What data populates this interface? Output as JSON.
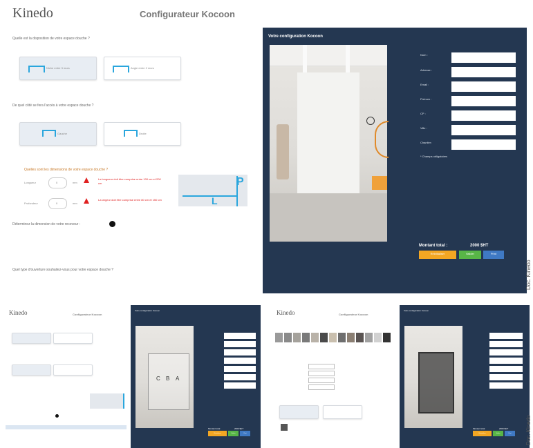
{
  "top": {
    "logo": "Kinedo",
    "title": "Configurateur Kocoon",
    "q1": "Quelle est la disposition de votre espace douche ?",
    "q1_opt1": "Niche entre 3 murs",
    "q1_opt2": "Angle entre 2 murs",
    "q2": "De quel côté se fera l'accès à votre espace douche ?",
    "q2_opt1": "Gauche",
    "q2_opt2": "Droite",
    "q3": "Quelles sont les dimensions de votre espace douche ?",
    "length_label": "Longueur",
    "length_value": "0",
    "length_unit": "mm",
    "length_error": "La longueur doit être comprise entre 100 cm et 200 cm",
    "depth_label": "Profondeur",
    "depth_value": "0",
    "depth_unit": "mm",
    "depth_error": "La largeur doit être comprise entre 80 cm et 150 cm",
    "diagram_p": "P",
    "diagram_l": "L",
    "dims_hint": "Déterminez la dimension de votre receveur :",
    "q4": "Quel type d'ouverture souhaitez-vous pour votre espace douche ?",
    "panel_title": "Votre configuration Kocoon",
    "fields": [
      "Nom :",
      "Adresse :",
      "Email :",
      "Prénom :",
      "CP :",
      "Ville :",
      "Chantier :"
    ],
    "required_note": "* Champs obligatoires",
    "total_label": "Montant total :",
    "total_value": "2000 $HT",
    "btn_orange": "Réinitialiser",
    "btn_green": "Valider",
    "btn_blue": "Print",
    "credit": "Doc. Kinedo"
  },
  "bottom_left": {
    "logo": "Kinedo",
    "title": "Configurateur Kocoon",
    "panel_title": "Votre configuration Kocoon",
    "abc": [
      "C",
      "B",
      "A"
    ],
    "total_label": "Montant total",
    "total_value": "2000 $HT",
    "btn_orange": "Réinitialiser",
    "btn_green": "Valider",
    "btn_blue": "Print",
    "credit": "Doc. Kinedo"
  },
  "bottom_right": {
    "logo": "Kinedo",
    "title": "Configurateur Kocoon",
    "panel_title": "Votre configuration Kocoon",
    "total_label": "Montant total",
    "total_value": "2000 $HT",
    "btn_orange": "Réinitialiser",
    "btn_green": "Valider",
    "btn_blue": "Print",
    "credit": "Doc. Kinedo"
  },
  "colors": {
    "navy": "#243751",
    "accent_blue": "#2aa6dd",
    "error_red": "#e02020",
    "btn_orange": "#f3a623",
    "btn_green": "#58b547",
    "btn_blue": "#3f79c4"
  }
}
